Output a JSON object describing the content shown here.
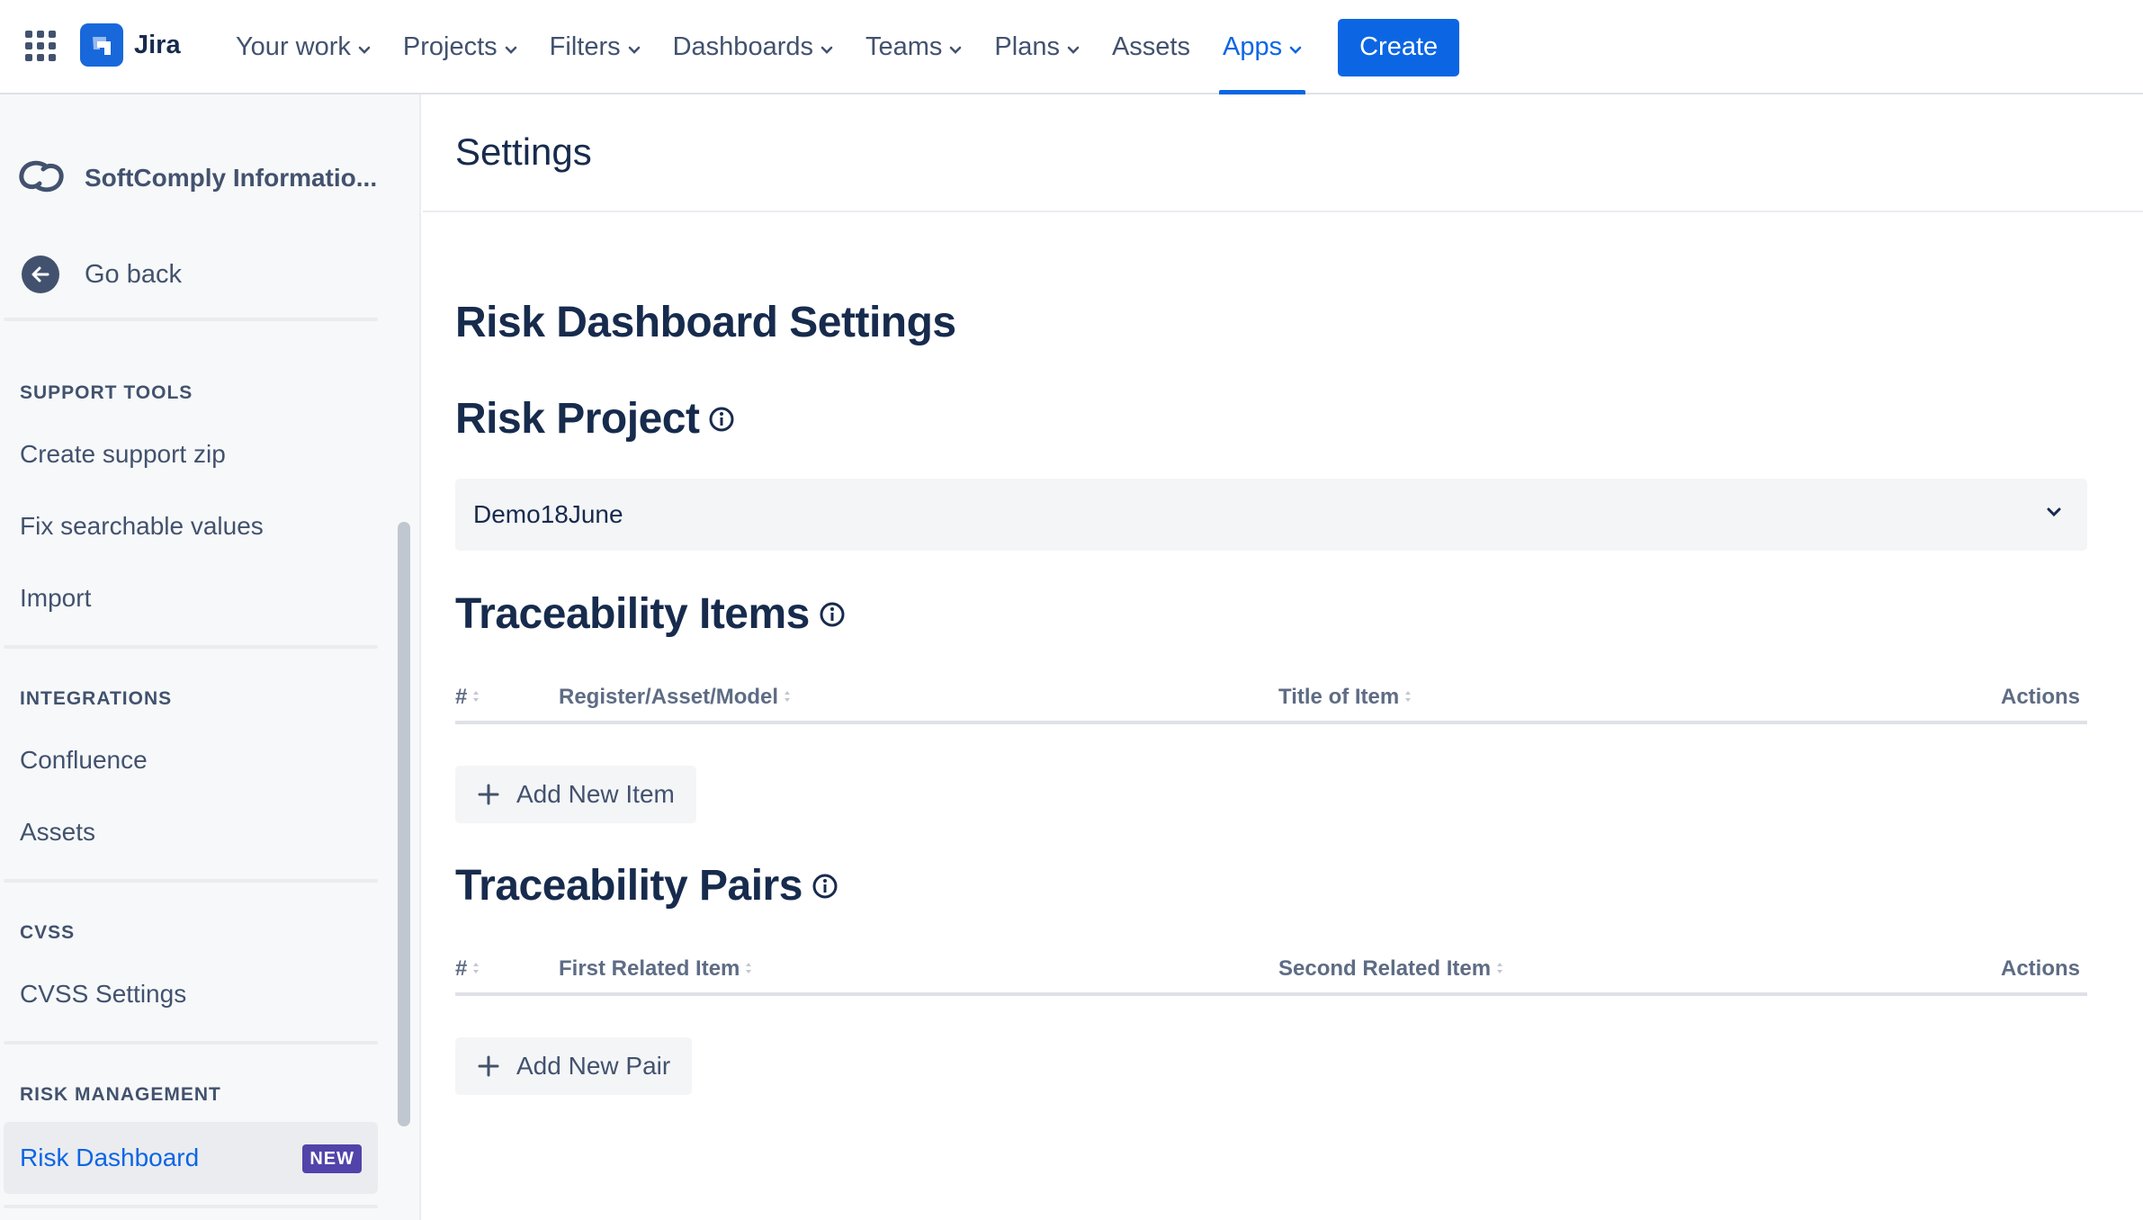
{
  "topbar": {
    "product": "Jira",
    "nav": [
      {
        "label": "Your work",
        "dropdown": true
      },
      {
        "label": "Projects",
        "dropdown": true
      },
      {
        "label": "Filters",
        "dropdown": true
      },
      {
        "label": "Dashboards",
        "dropdown": true
      },
      {
        "label": "Teams",
        "dropdown": true
      },
      {
        "label": "Plans",
        "dropdown": true
      },
      {
        "label": "Assets",
        "dropdown": false
      },
      {
        "label": "Apps",
        "dropdown": true,
        "active": true
      }
    ],
    "create_label": "Create",
    "accent": "#0c66e4"
  },
  "sidebar": {
    "project_name": "SoftComply Informatio...",
    "go_back": "Go back",
    "sections": [
      {
        "title": "SUPPORT TOOLS",
        "items": [
          "Create support zip",
          "Fix searchable values",
          "Import"
        ]
      },
      {
        "title": "INTEGRATIONS",
        "items": [
          "Confluence",
          "Assets"
        ]
      },
      {
        "title": "CVSS",
        "items": [
          "CVSS Settings"
        ]
      },
      {
        "title": "RISK MANAGEMENT",
        "items": [
          "Risk Dashboard"
        ]
      }
    ],
    "active_item": "Risk Dashboard",
    "active_badge": "NEW"
  },
  "main": {
    "page_title": "Settings",
    "heading": "Risk Dashboard Settings",
    "risk_project": {
      "title": "Risk Project",
      "selected": "Demo18June"
    },
    "traceability_items": {
      "title": "Traceability Items",
      "columns": [
        "#",
        "Register/Asset/Model",
        "Title of Item",
        "Actions"
      ],
      "rows": [],
      "add_label": "Add New Item"
    },
    "traceability_pairs": {
      "title": "Traceability Pairs",
      "columns": [
        "#",
        "First Related Item",
        "Second Related Item",
        "Actions"
      ],
      "rows": [],
      "add_label": "Add New Pair"
    }
  }
}
